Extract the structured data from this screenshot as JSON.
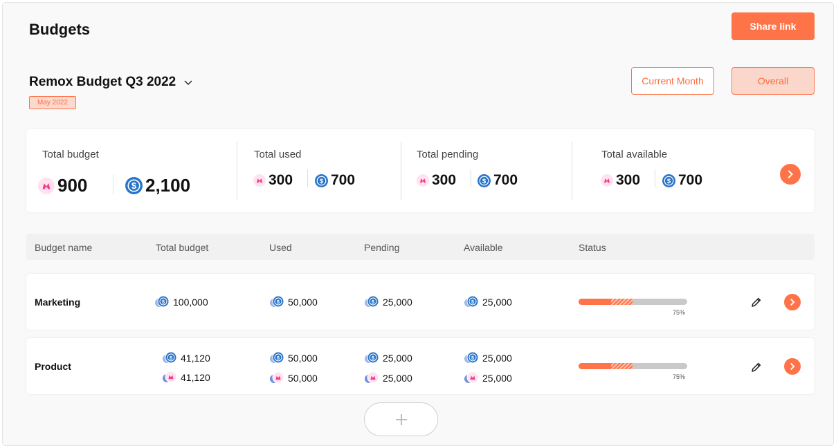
{
  "header": {
    "title": "Budgets",
    "share_label": "Share link"
  },
  "budget": {
    "name": "Remox Budget Q3 2022",
    "date_badge": "May 2022"
  },
  "filters": {
    "current_month": "Current Month",
    "overall": "Overall"
  },
  "colors": {
    "accent": "#ff7348",
    "celo": "#f33a8e",
    "usdc": "#2775ca"
  },
  "summary": {
    "total_budget": {
      "label": "Total budget",
      "celo": "900",
      "usdc": "2,100"
    },
    "total_used": {
      "label": "Total used",
      "celo": "300",
      "usdc": "700"
    },
    "total_pending": {
      "label": "Total pending",
      "celo": "300",
      "usdc": "700"
    },
    "total_available": {
      "label": "Total available",
      "celo": "300",
      "usdc": "700"
    }
  },
  "table": {
    "headers": [
      "Budget name",
      "Total budget",
      "Used",
      "Pending",
      "Available",
      "Status"
    ],
    "rows": [
      {
        "name": "Marketing",
        "total": [
          "100,000"
        ],
        "used": [
          "50,000"
        ],
        "pending": [
          "25,000"
        ],
        "available": [
          "25,000"
        ],
        "used_fraction": 0.3,
        "pending_fraction": 0.2,
        "status_pct": "75%"
      },
      {
        "name": "Product",
        "total": [
          "41,120",
          "41,120"
        ],
        "used": [
          "50,000",
          "50,000"
        ],
        "pending": [
          "25,000",
          "25,000"
        ],
        "available": [
          "25,000",
          "25,000"
        ],
        "used_fraction": 0.3,
        "pending_fraction": 0.2,
        "status_pct": "75%"
      }
    ]
  },
  "add_button": {
    "icon": "plus-icon"
  }
}
